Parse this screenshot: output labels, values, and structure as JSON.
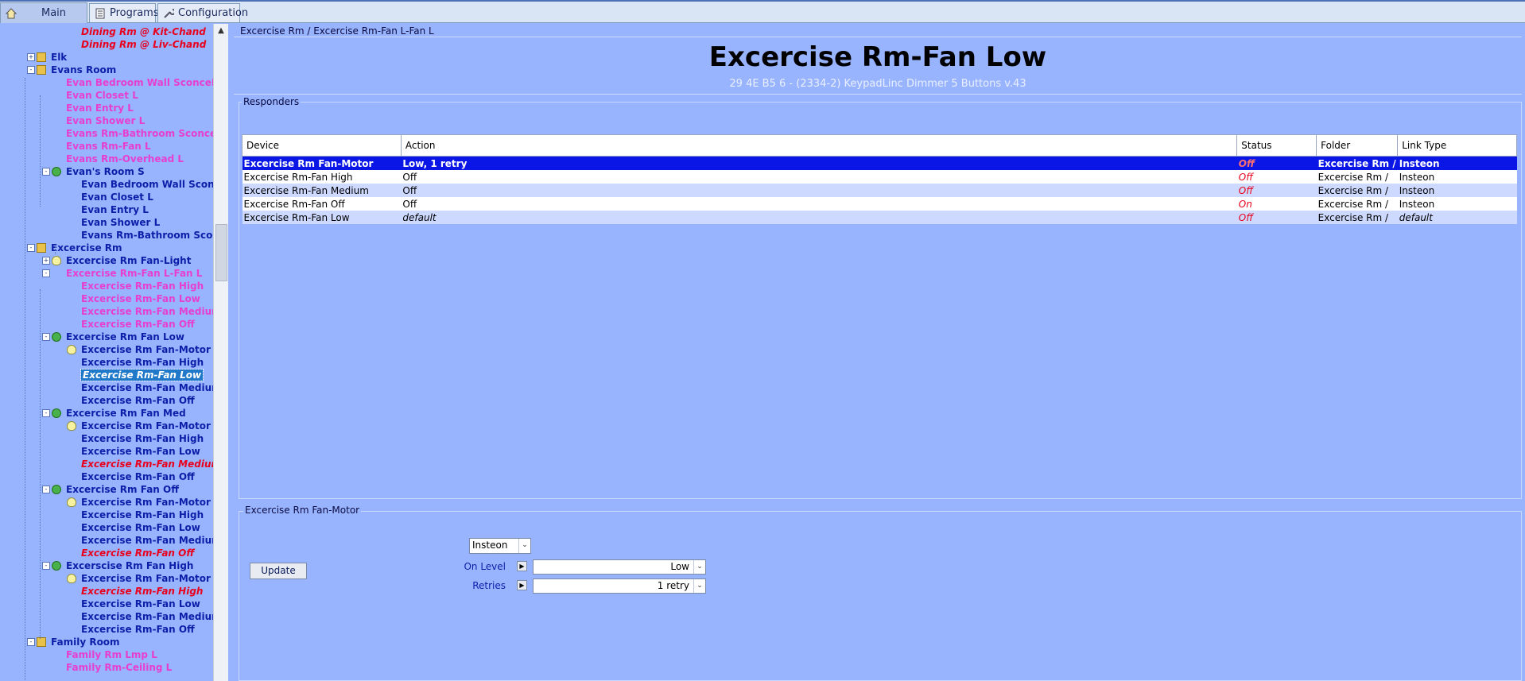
{
  "tabs": [
    {
      "label": "Main",
      "icon": "home-icon"
    },
    {
      "label": "Programs",
      "icon": "programs-icon"
    },
    {
      "label": "Configuration",
      "icon": "wrench-icon"
    }
  ],
  "tree": [
    {
      "label": "Dining Rm @ Kit-Chand",
      "style": "red",
      "icon": "device"
    },
    {
      "label": "Dining Rm @ Liv-Chand",
      "style": "red",
      "icon": "device"
    },
    {
      "label": "Elk",
      "style": "blue",
      "icon": "folder"
    },
    {
      "label": "Evans Room",
      "style": "blue",
      "icon": "folder"
    },
    {
      "label": "Evan Bedroom Wall SconceL",
      "style": "pink",
      "icon": "device"
    },
    {
      "label": "Evan Closet L",
      "style": "pink",
      "icon": "device"
    },
    {
      "label": "Evan Entry L",
      "style": "pink",
      "icon": "device"
    },
    {
      "label": "Evan Shower L",
      "style": "pink",
      "icon": "device"
    },
    {
      "label": "Evans Rm-Bathroom Sconces L",
      "style": "pink",
      "icon": "device"
    },
    {
      "label": "Evans Rm-Fan L",
      "style": "pink",
      "icon": "device"
    },
    {
      "label": "Evans Rm-Overhead L",
      "style": "pink",
      "icon": "device"
    },
    {
      "label": "Evan's Room S",
      "style": "blue",
      "icon": "scene"
    },
    {
      "label": "Evan Bedroom Wall SconceL",
      "style": "blue",
      "icon": "device"
    },
    {
      "label": "Evan Closet L",
      "style": "blue",
      "icon": "device"
    },
    {
      "label": "Evan Entry L",
      "style": "blue",
      "icon": "device"
    },
    {
      "label": "Evan Shower L",
      "style": "blue",
      "icon": "device"
    },
    {
      "label": "Evans Rm-Bathroom Sconces",
      "style": "blue",
      "icon": "device"
    },
    {
      "label": "Excercise Rm",
      "style": "blue",
      "icon": "folder"
    },
    {
      "label": "Excercise Rm Fan-Light",
      "style": "blue",
      "icon": "bulb"
    },
    {
      "label": "Excercise Rm-Fan L-Fan L",
      "style": "pink",
      "icon": "device"
    },
    {
      "label": "Excercise Rm-Fan High",
      "style": "pink",
      "icon": "device"
    },
    {
      "label": "Excercise Rm-Fan Low",
      "style": "pink",
      "icon": "device"
    },
    {
      "label": "Excercise Rm-Fan Medium",
      "style": "pink",
      "icon": "device"
    },
    {
      "label": "Excercise Rm-Fan Off",
      "style": "pink",
      "icon": "device"
    },
    {
      "label": "Excercise Rm Fan Low",
      "style": "blue",
      "icon": "scene"
    },
    {
      "label": "Excercise Rm Fan-Motor",
      "style": "blue",
      "icon": "bulb"
    },
    {
      "label": "Excercise Rm-Fan High",
      "style": "blue",
      "icon": "device"
    },
    {
      "label": "Excercise Rm-Fan Low",
      "style": "selected",
      "icon": "device"
    },
    {
      "label": "Excercise Rm-Fan Medium",
      "style": "blue",
      "icon": "device"
    },
    {
      "label": "Excercise Rm-Fan Off",
      "style": "blue",
      "icon": "device"
    },
    {
      "label": "Excercise Rm Fan Med",
      "style": "blue",
      "icon": "scene"
    },
    {
      "label": "Excercise Rm Fan-Motor",
      "style": "blue",
      "icon": "bulb"
    },
    {
      "label": "Excercise Rm-Fan High",
      "style": "blue",
      "icon": "device"
    },
    {
      "label": "Excercise Rm-Fan Low",
      "style": "blue",
      "icon": "device"
    },
    {
      "label": "Excercise Rm-Fan Medium",
      "style": "red",
      "icon": "device"
    },
    {
      "label": "Excercise Rm-Fan Off",
      "style": "blue",
      "icon": "device"
    },
    {
      "label": "Excercise Rm Fan Off",
      "style": "blue",
      "icon": "scene"
    },
    {
      "label": "Excercise Rm Fan-Motor",
      "style": "blue",
      "icon": "bulb"
    },
    {
      "label": "Excercise Rm-Fan High",
      "style": "blue",
      "icon": "device"
    },
    {
      "label": "Excercise Rm-Fan Low",
      "style": "blue",
      "icon": "device"
    },
    {
      "label": "Excercise Rm-Fan Medium",
      "style": "blue",
      "icon": "device"
    },
    {
      "label": "Excercise Rm-Fan Off",
      "style": "red",
      "icon": "device"
    },
    {
      "label": "Excerscise Rm Fan High",
      "style": "blue",
      "icon": "scene"
    },
    {
      "label": "Excercise Rm Fan-Motor",
      "style": "blue",
      "icon": "bulb"
    },
    {
      "label": "Excercise Rm-Fan High",
      "style": "red",
      "icon": "device"
    },
    {
      "label": "Excercise Rm-Fan Low",
      "style": "blue",
      "icon": "device"
    },
    {
      "label": "Excercise Rm-Fan Medium",
      "style": "blue",
      "icon": "device"
    },
    {
      "label": "Excercise Rm-Fan Off",
      "style": "blue",
      "icon": "device"
    },
    {
      "label": "Family Room",
      "style": "blue",
      "icon": "folder"
    },
    {
      "label": "Family Rm Lmp L",
      "style": "pink",
      "icon": "device"
    },
    {
      "label": "Family Rm-Ceiling L",
      "style": "pink",
      "icon": "device"
    }
  ],
  "breadcrumb": "Excercise Rm / Excercise Rm-Fan L-Fan L",
  "title": "Excercise Rm-Fan Low",
  "subtitle": "29 4E B5 6 - (2334-2) KeypadLinc Dimmer 5 Buttons v.43",
  "responders": {
    "legend": "Responders",
    "columns": [
      "Device",
      "Action",
      "Status",
      "Folder",
      "Link Type"
    ],
    "rows": [
      {
        "device": "Excercise Rm Fan-Motor",
        "action": "Low, 1 retry",
        "status": "Off",
        "folder": "Excercise Rm /",
        "link": "Insteon"
      },
      {
        "device": "Excercise Rm-Fan High",
        "action": "Off",
        "status": "Off",
        "folder": "Excercise Rm /",
        "link": "Insteon"
      },
      {
        "device": "Excercise Rm-Fan Medium",
        "action": "Off",
        "status": "Off",
        "folder": "Excercise Rm /",
        "link": "Insteon"
      },
      {
        "device": "Excercise Rm-Fan Off",
        "action": "Off",
        "status": "On",
        "folder": "Excercise Rm /",
        "link": "Insteon"
      },
      {
        "device": "Excercise Rm-Fan Low",
        "action": "default",
        "status": "Off",
        "folder": "Excercise Rm /",
        "link": "default"
      }
    ]
  },
  "detail": {
    "legend": "Excercise Rm Fan-Motor",
    "update_label": "Update",
    "protocol": "Insteon",
    "on_level_label": "On Level",
    "on_level_value": "Low",
    "retries_label": "Retries",
    "retries_value": "1 retry"
  }
}
